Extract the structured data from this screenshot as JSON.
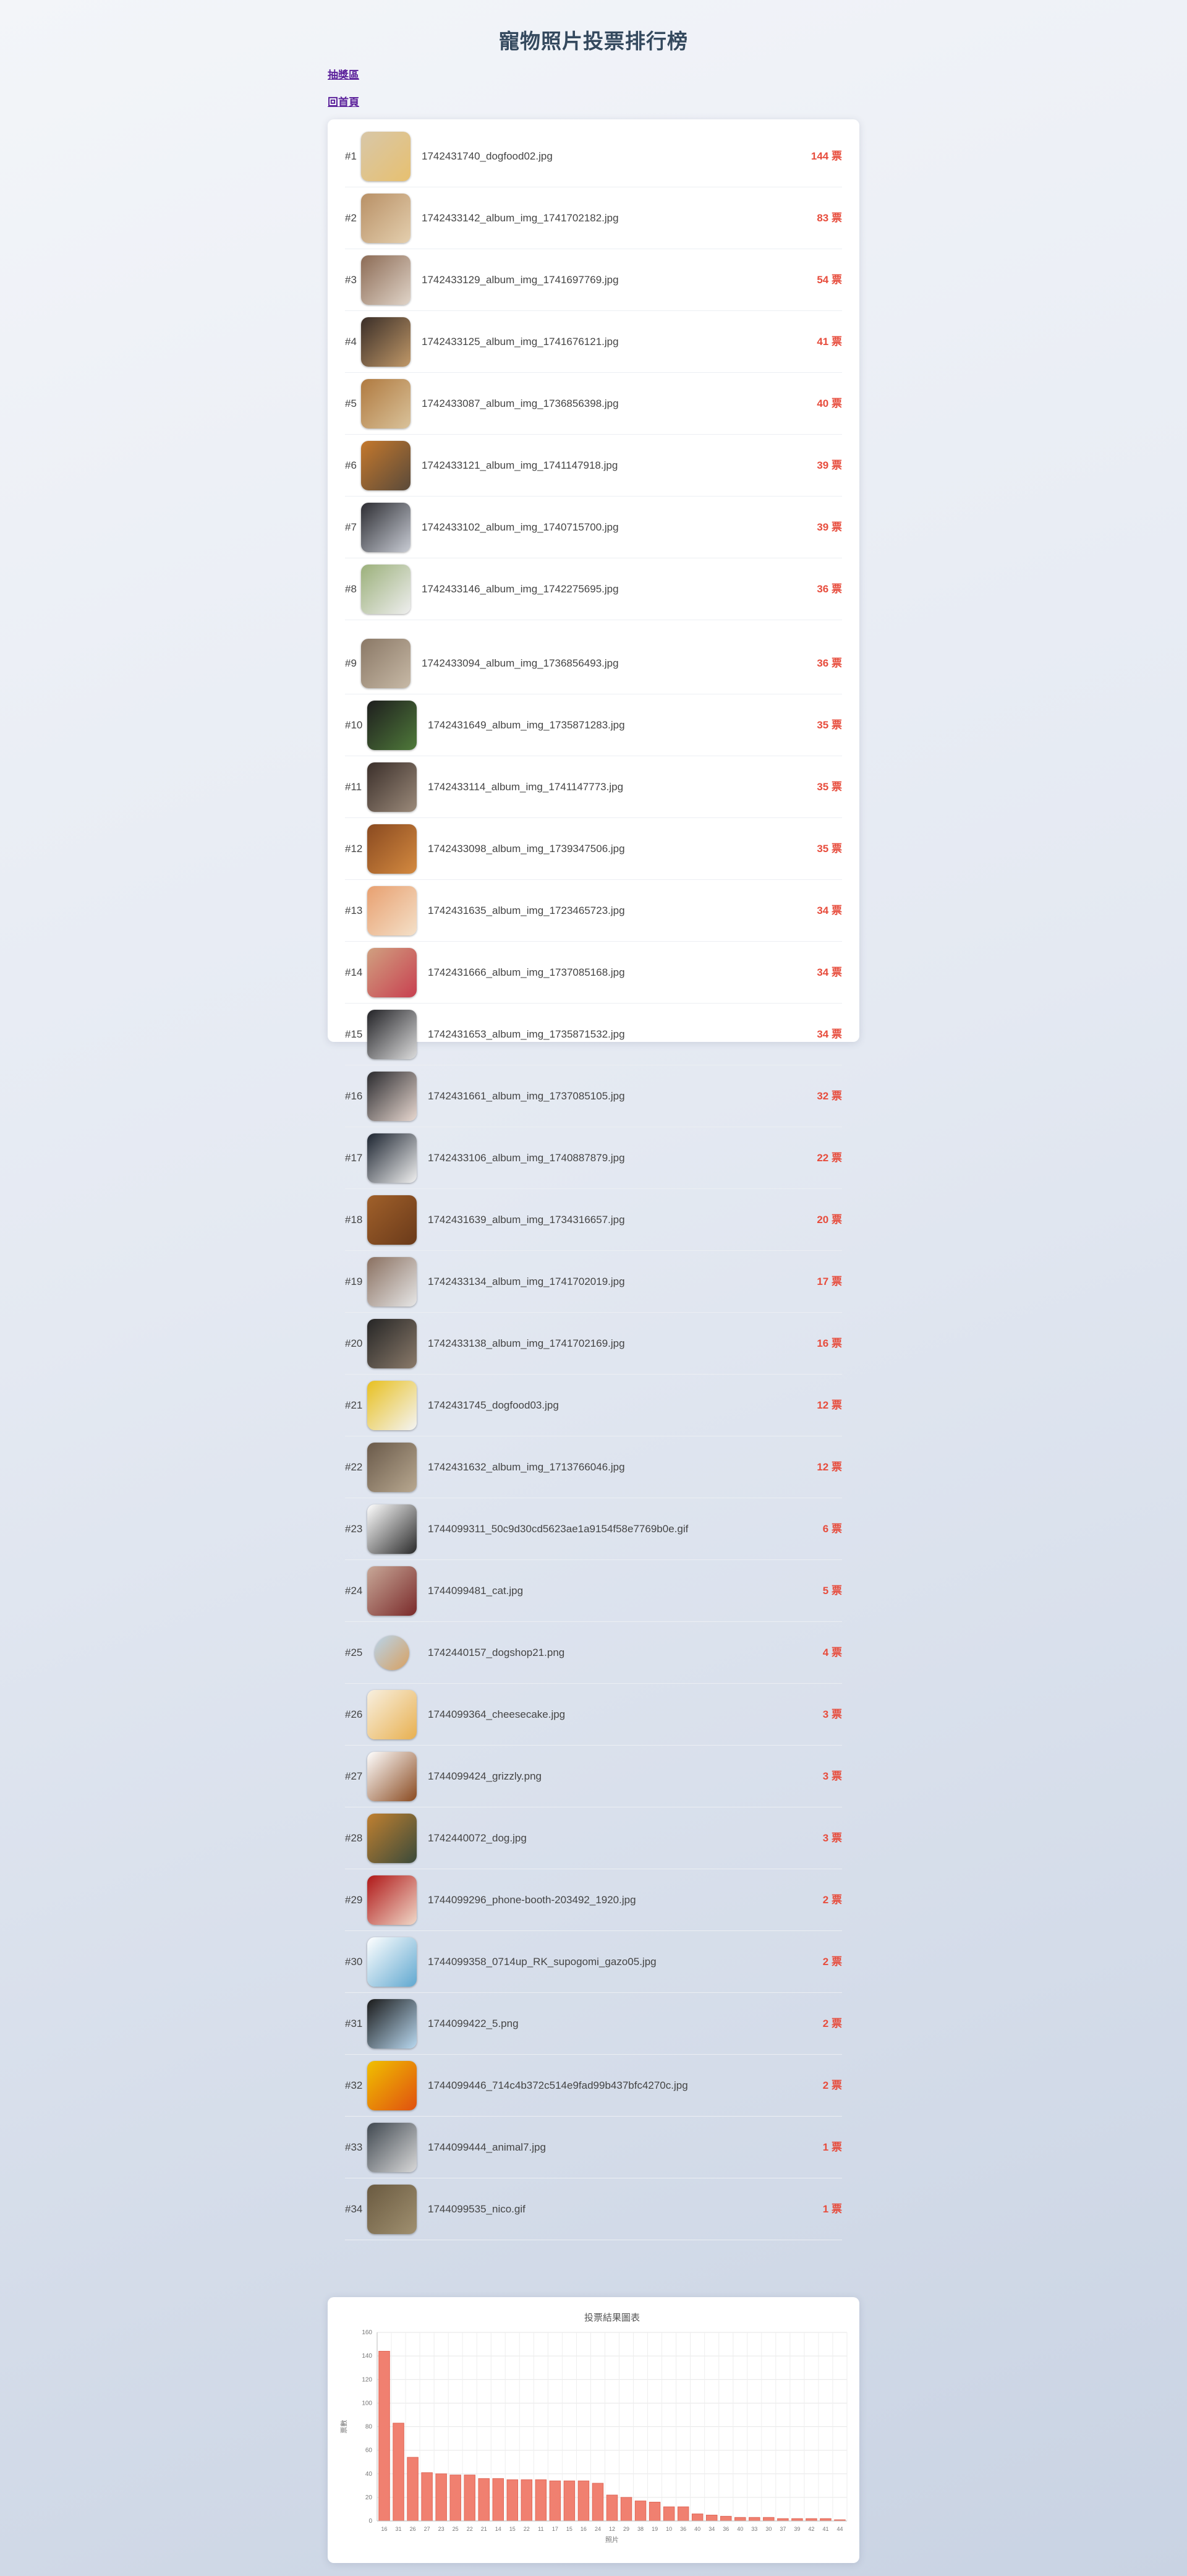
{
  "page": {
    "title": "寵物照片投票排行榜",
    "links": {
      "lottery": "抽獎區",
      "home": "回首頁"
    }
  },
  "colors": {
    "accent": "#e74c3c",
    "bar": "#f08070",
    "link": "#5a1f9a"
  },
  "vote_suffix": "票",
  "ranking": [
    {
      "rank": "#1",
      "file": "1742431740_dogfood02.jpg",
      "votes": 144,
      "thumb": [
        "#d8c7a8",
        "#e7c070"
      ]
    },
    {
      "rank": "#2",
      "file": "1742433142_album_img_1741702182.jpg",
      "votes": 83,
      "thumb": [
        "#b89066",
        "#e4cfae"
      ]
    },
    {
      "rank": "#3",
      "file": "1742433129_album_img_1741697769.jpg",
      "votes": 54,
      "thumb": [
        "#8c6b55",
        "#e0d4c8"
      ]
    },
    {
      "rank": "#4",
      "file": "1742433125_album_img_1741676121.jpg",
      "votes": 41,
      "thumb": [
        "#3a2e28",
        "#c09868"
      ]
    },
    {
      "rank": "#5",
      "file": "1742433087_album_img_1736856398.jpg",
      "votes": 40,
      "thumb": [
        "#b07a40",
        "#d9c29a"
      ]
    },
    {
      "rank": "#6",
      "file": "1742433121_album_img_1741147918.jpg",
      "votes": 39,
      "thumb": [
        "#c4782c",
        "#5a4a3a"
      ]
    },
    {
      "rank": "#7",
      "file": "1742433102_album_img_1740715700.jpg",
      "votes": 39,
      "thumb": [
        "#2d2d33",
        "#c8ccd4"
      ]
    },
    {
      "rank": "#8",
      "file": "1742433146_album_img_1742275695.jpg",
      "votes": 36,
      "thumb": [
        "#9bb07a",
        "#eeeeee"
      ]
    },
    {
      "rank": "#9",
      "file": "1742433094_album_img_1736856493.jpg",
      "votes": 36,
      "thumb": [
        "#8a7866",
        "#c7b9a6"
      ]
    },
    {
      "rank": "#10",
      "file": "1742431649_album_img_1735871283.jpg",
      "votes": 35,
      "thumb": [
        "#1e1e1e",
        "#4f7a3a"
      ]
    },
    {
      "rank": "#11",
      "file": "1742433114_album_img_1741147773.jpg",
      "votes": 35,
      "thumb": [
        "#3b2f2a",
        "#9b8a7a"
      ]
    },
    {
      "rank": "#12",
      "file": "1742433098_album_img_1739347506.jpg",
      "votes": 35,
      "thumb": [
        "#8a4a20",
        "#d48a40"
      ]
    },
    {
      "rank": "#13",
      "file": "1742431635_album_img_1723465723.jpg",
      "votes": 34,
      "thumb": [
        "#e8a070",
        "#f4e0c8"
      ]
    },
    {
      "rank": "#14",
      "file": "1742431666_album_img_1737085168.jpg",
      "votes": 34,
      "thumb": [
        "#d0a080",
        "#c84050"
      ]
    },
    {
      "rank": "#15",
      "file": "1742431653_album_img_1735871532.jpg",
      "votes": 34,
      "thumb": [
        "#222226",
        "#dcdcdc"
      ]
    },
    {
      "rank": "#16",
      "file": "1742431661_album_img_1737085105.jpg",
      "votes": 32,
      "thumb": [
        "#2a2a2e",
        "#e8d8d0"
      ]
    },
    {
      "rank": "#17",
      "file": "1742433106_album_img_1740887879.jpg",
      "votes": 22,
      "thumb": [
        "#1c2430",
        "#f0f0f0"
      ]
    },
    {
      "rank": "#18",
      "file": "1742431639_album_img_1734316657.jpg",
      "votes": 20,
      "thumb": [
        "#a0602a",
        "#6a3a1a"
      ]
    },
    {
      "rank": "#19",
      "file": "1742433134_album_img_1741702019.jpg",
      "votes": 17,
      "thumb": [
        "#8a7060",
        "#e6e6e6"
      ]
    },
    {
      "rank": "#20",
      "file": "1742433138_album_img_1741702169.jpg",
      "votes": 16,
      "thumb": [
        "#262626",
        "#8a7a6a"
      ]
    },
    {
      "rank": "#21",
      "file": "1742431745_dogfood03.jpg",
      "votes": 12,
      "thumb": [
        "#e8c020",
        "#f4f4f4"
      ]
    },
    {
      "rank": "#22",
      "file": "1742431632_album_img_1713766046.jpg",
      "votes": 12,
      "thumb": [
        "#6a5a4a",
        "#b8a890"
      ]
    },
    {
      "rank": "#23",
      "file": "1744099311_50c9d30cd5623ae1a9154f58e7769b0e.gif",
      "votes": 6,
      "thumb": [
        "#ffffff",
        "#2a2a2a"
      ]
    },
    {
      "rank": "#24",
      "file": "1744099481_cat.jpg",
      "votes": 5,
      "thumb": [
        "#c8a898",
        "#7a2a2a"
      ]
    },
    {
      "rank": "#25",
      "file": "1742440157_dogshop21.png",
      "votes": 4,
      "thumb": [
        "#b8d4ea",
        "#d8a060"
      ],
      "circle": true
    },
    {
      "rank": "#26",
      "file": "1744099364_cheesecake.jpg",
      "votes": 3,
      "thumb": [
        "#f8f0e0",
        "#e8b050"
      ]
    },
    {
      "rank": "#27",
      "file": "1744099424_grizzly.png",
      "votes": 3,
      "thumb": [
        "#ffffff",
        "#8a4a20"
      ]
    },
    {
      "rank": "#28",
      "file": "1742440072_dog.jpg",
      "votes": 3,
      "thumb": [
        "#c08030",
        "#3a4a3a"
      ]
    },
    {
      "rank": "#29",
      "file": "1744099296_phone-booth-203492_1920.jpg",
      "votes": 2,
      "thumb": [
        "#b01818",
        "#f0d8c8"
      ]
    },
    {
      "rank": "#30",
      "file": "1744099358_0714up_RK_supogomi_gazo05.jpg",
      "votes": 2,
      "thumb": [
        "#ffffff",
        "#60a8d0"
      ]
    },
    {
      "rank": "#31",
      "file": "1744099422_5.png",
      "votes": 2,
      "thumb": [
        "#1a1a1a",
        "#b8d8f0"
      ]
    },
    {
      "rank": "#32",
      "file": "1744099446_714c4b372c514e9fad99b437bfc4270c.jpg",
      "votes": 2,
      "thumb": [
        "#f0c000",
        "#e05010"
      ]
    },
    {
      "rank": "#33",
      "file": "1744099444_animal7.jpg",
      "votes": 1,
      "thumb": [
        "#404850",
        "#d8d8d8"
      ]
    },
    {
      "rank": "#34",
      "file": "1744099535_nico.gif",
      "votes": 1,
      "thumb": [
        "#6a5a40",
        "#a09070"
      ]
    }
  ],
  "chart_data": {
    "type": "bar",
    "title": "投票結果圖表",
    "ylabel": "票數",
    "xlabel": "照片",
    "ylim": [
      0,
      160
    ],
    "yticks": [
      0,
      20,
      40,
      60,
      80,
      100,
      120,
      140,
      160
    ],
    "grid": true,
    "categories": [
      "16",
      "31",
      "26",
      "27",
      "23",
      "25",
      "22",
      "21",
      "14",
      "15",
      "22",
      "11",
      "17",
      "15",
      "16",
      "24",
      "12",
      "29",
      "38",
      "19",
      "10",
      "36",
      "40",
      "34",
      "36",
      "40",
      "33",
      "30",
      "37",
      "39",
      "42",
      "41",
      "44"
    ],
    "values": [
      144,
      83,
      54,
      41,
      40,
      39,
      39,
      36,
      36,
      35,
      35,
      35,
      34,
      34,
      34,
      32,
      22,
      20,
      17,
      16,
      12,
      12,
      6,
      5,
      4,
      3,
      3,
      3,
      2,
      2,
      2,
      2,
      1
    ]
  }
}
